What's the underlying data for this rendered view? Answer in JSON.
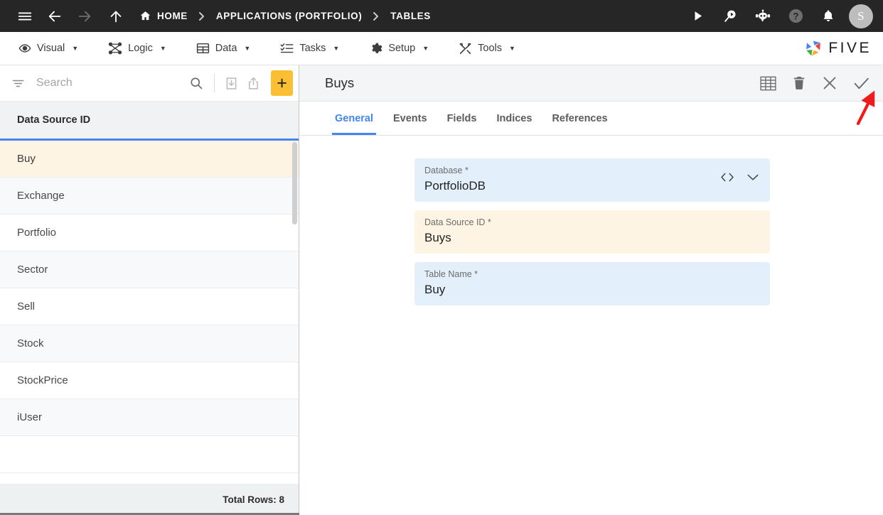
{
  "topbar": {
    "menu_icon": "hamburger-icon",
    "back_icon": "arrow-left-icon",
    "forward_icon": "arrow-right-icon",
    "up_icon": "arrow-up-icon",
    "breadcrumbs": [
      {
        "label": "HOME",
        "icon": "home-icon"
      },
      {
        "label": "APPLICATIONS (PORTFOLIO)",
        "icon": ""
      },
      {
        "label": "TABLES",
        "icon": ""
      }
    ],
    "separator": "›",
    "actions": [
      {
        "name": "run-icon",
        "title": "Run"
      },
      {
        "name": "search-run-icon",
        "title": "Search"
      },
      {
        "name": "robot-chat-icon",
        "title": "Assistant"
      },
      {
        "name": "help-icon",
        "title": "Help"
      },
      {
        "name": "bell-icon",
        "title": "Notifications"
      }
    ],
    "avatar_letter": "S",
    "accent_color": "#f9bf2f",
    "background_color": "#262626"
  },
  "menubar": {
    "items": [
      {
        "label": "Visual",
        "icon": "eye-icon"
      },
      {
        "label": "Logic",
        "icon": "logic-nodes-icon"
      },
      {
        "label": "Data",
        "icon": "table-icon"
      },
      {
        "label": "Tasks",
        "icon": "task-list-icon"
      },
      {
        "label": "Setup",
        "icon": "gear-icon"
      },
      {
        "label": "Tools",
        "icon": "tools-icon"
      }
    ],
    "caret": "▼",
    "logo_text": "FIVE"
  },
  "sidebar": {
    "search": {
      "placeholder": "Search",
      "value": ""
    },
    "toolbar": [
      {
        "name": "filter-icon"
      },
      {
        "name": "search-icon"
      },
      {
        "name": "import-icon"
      },
      {
        "name": "export-icon"
      }
    ],
    "add_button_label": "+",
    "add_button_color": "#fbbf34",
    "column_header": "Data Source ID",
    "rows": [
      {
        "label": "Buy",
        "selected": true
      },
      {
        "label": "Exchange",
        "selected": false
      },
      {
        "label": "Portfolio",
        "selected": false
      },
      {
        "label": "Sector",
        "selected": false
      },
      {
        "label": "Sell",
        "selected": false
      },
      {
        "label": "Stock",
        "selected": false
      },
      {
        "label": "StockPrice",
        "selected": false
      },
      {
        "label": "iUser",
        "selected": false
      }
    ],
    "footer_text": "Total Rows: 8",
    "selected_row_color": "#fdf4e4",
    "header_underline_color": "#4285f4"
  },
  "detail": {
    "title": "Buys",
    "actions": [
      {
        "name": "grid-table-icon"
      },
      {
        "name": "delete-icon"
      },
      {
        "name": "close-icon"
      },
      {
        "name": "save-check-icon"
      }
    ],
    "tabs": [
      {
        "label": "General",
        "active": true
      },
      {
        "label": "Events",
        "active": false
      },
      {
        "label": "Fields",
        "active": false
      },
      {
        "label": "Indices",
        "active": false
      },
      {
        "label": "References",
        "active": false
      }
    ],
    "active_tab_color": "#4285f4",
    "fields": [
      {
        "label": "Database *",
        "value": "PortfolioDB",
        "style": "blue",
        "icons": [
          "code-brackets-icon",
          "chevron-down-icon"
        ]
      },
      {
        "label": "Data Source ID *",
        "value": "Buys",
        "style": "cream",
        "icons": []
      },
      {
        "label": "Table Name *",
        "value": "Buy",
        "style": "blue",
        "icons": []
      }
    ]
  },
  "annotation": {
    "arrow_color": "#ee1c1c",
    "points_to": "save-check-icon"
  }
}
